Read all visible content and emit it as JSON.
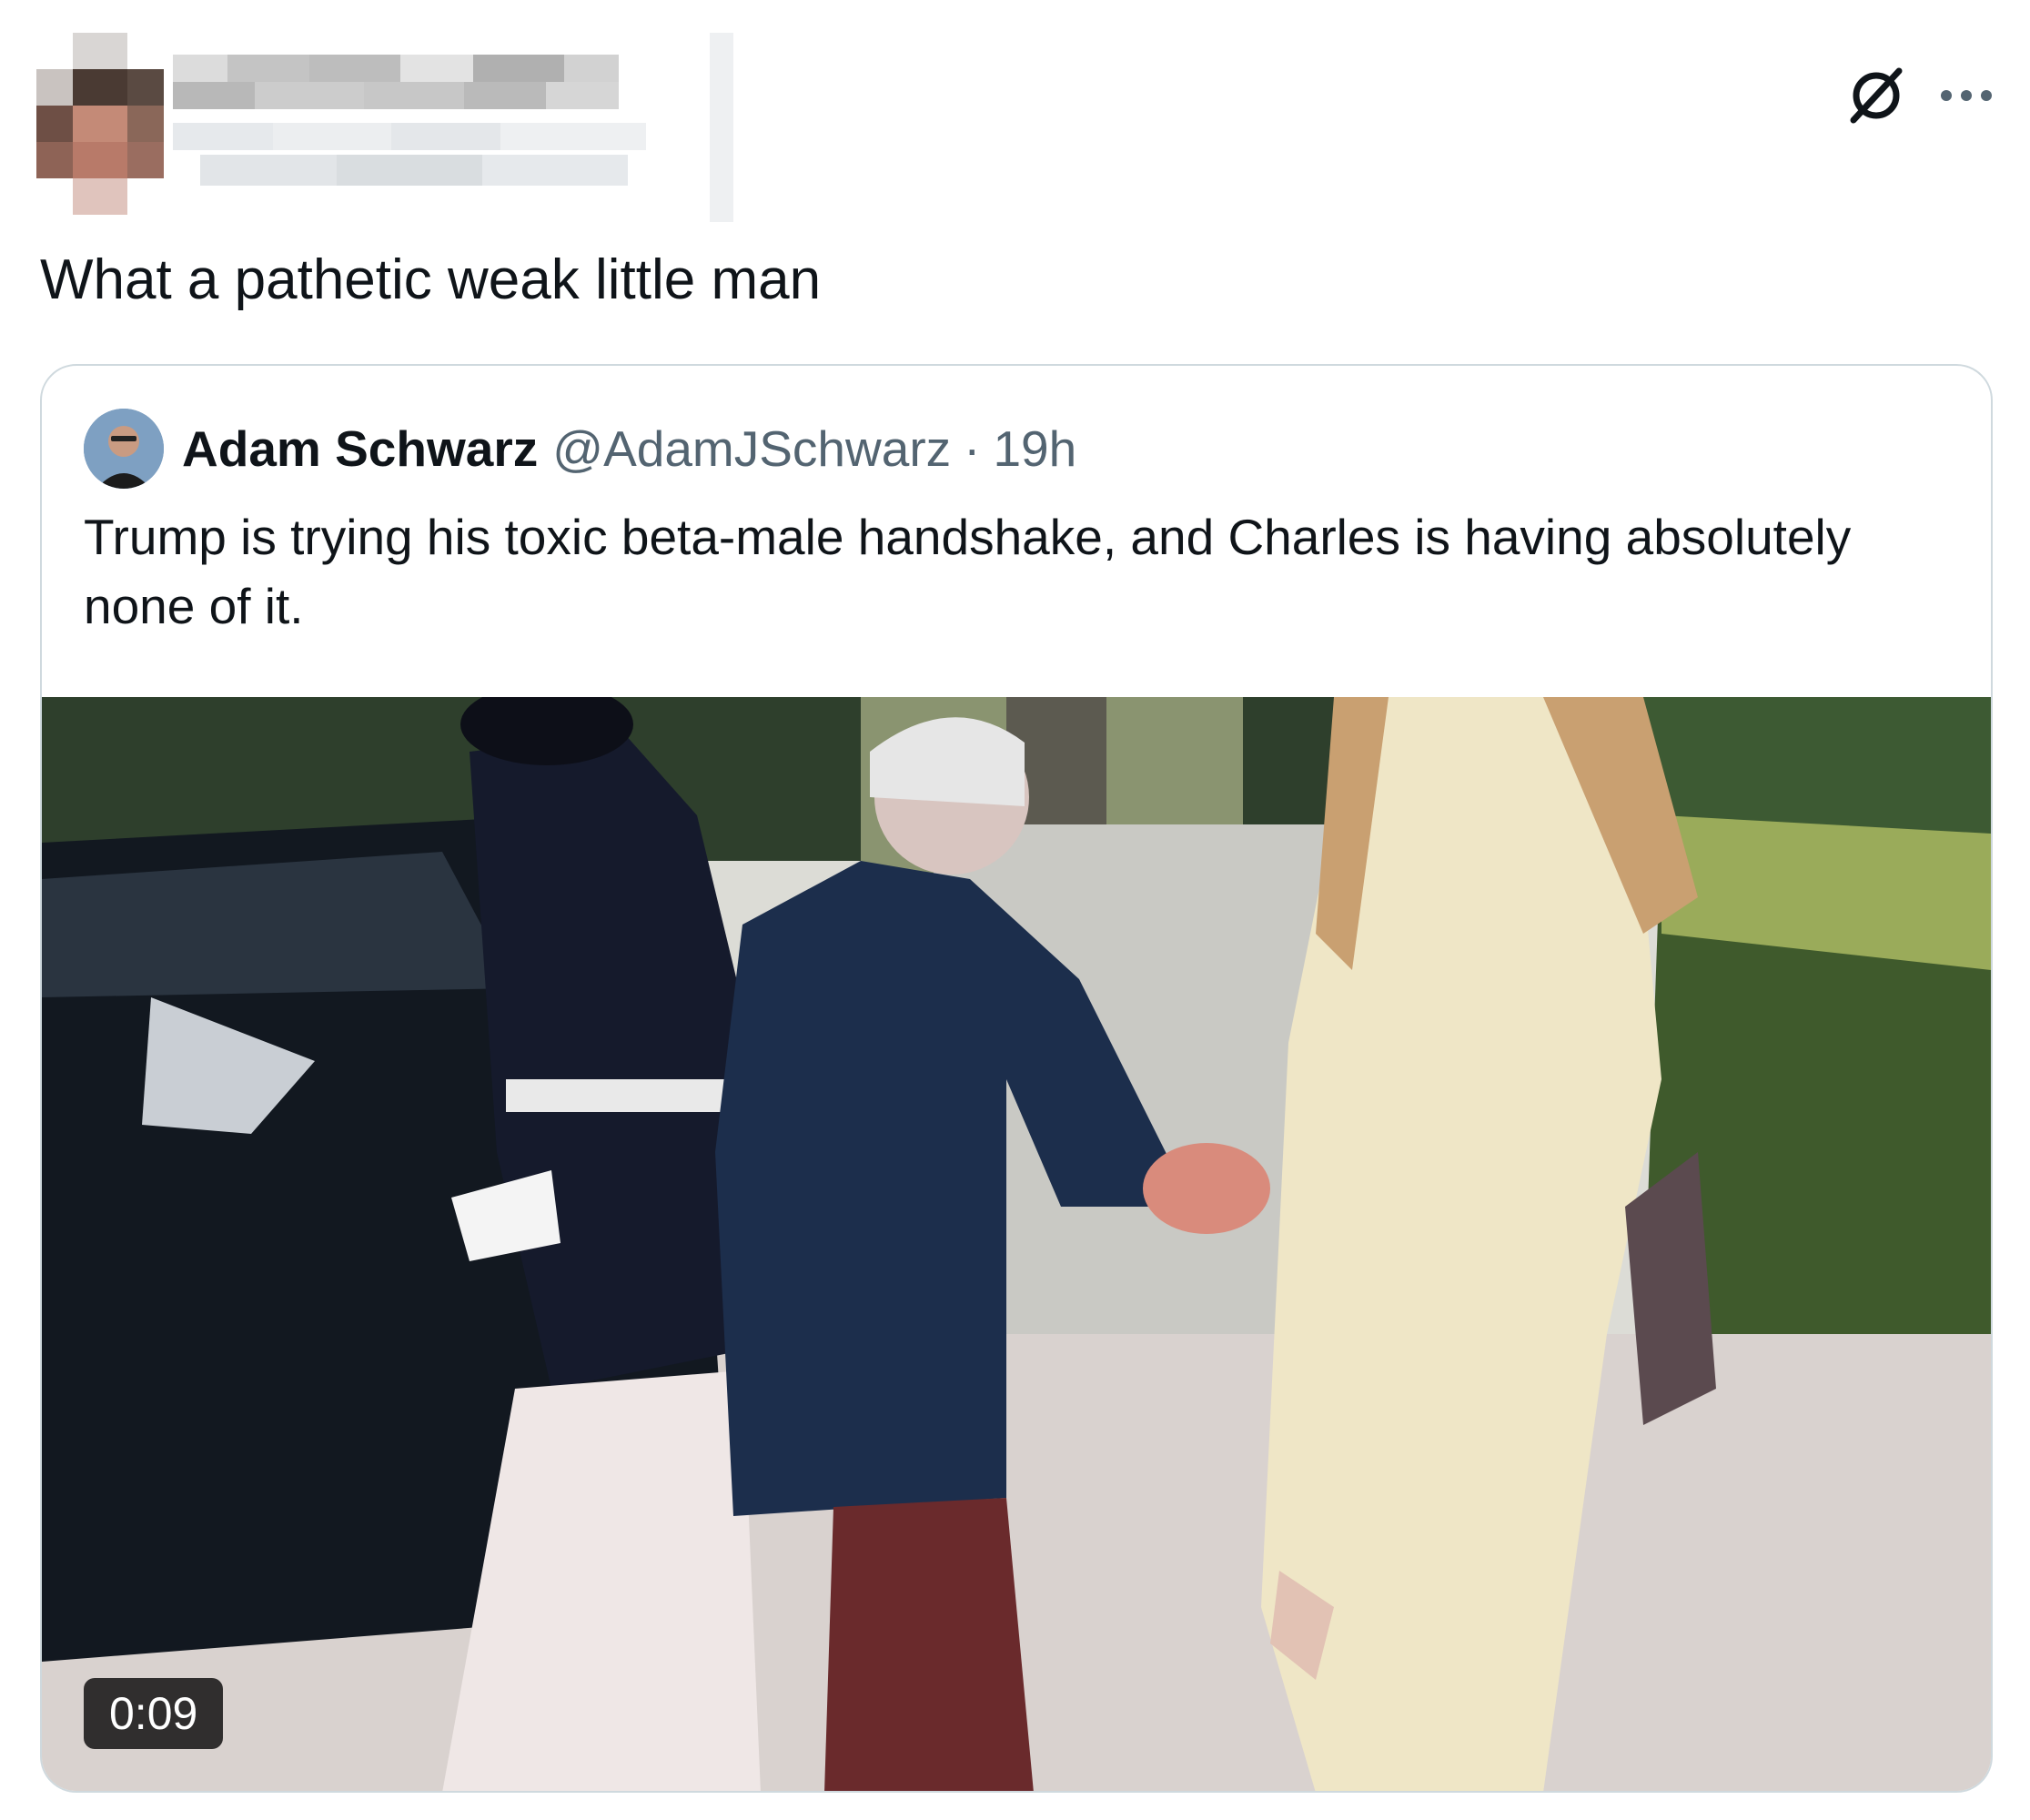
{
  "tweet": {
    "text": "What a pathetic weak little man"
  },
  "quoted": {
    "author": "Adam Schwarz",
    "handle": "@AdamJSchwarz",
    "separator": "·",
    "time": "19h",
    "text": "Trump is trying his toxic beta-male handshake, and Charles is having absolutely none of it.",
    "video_duration": "0:09"
  },
  "icons": {
    "grok": "grok-icon",
    "more": "more-dots-icon"
  },
  "colors": {
    "text_primary": "#0f1419",
    "text_secondary": "#536471",
    "border": "#cfd9de"
  }
}
